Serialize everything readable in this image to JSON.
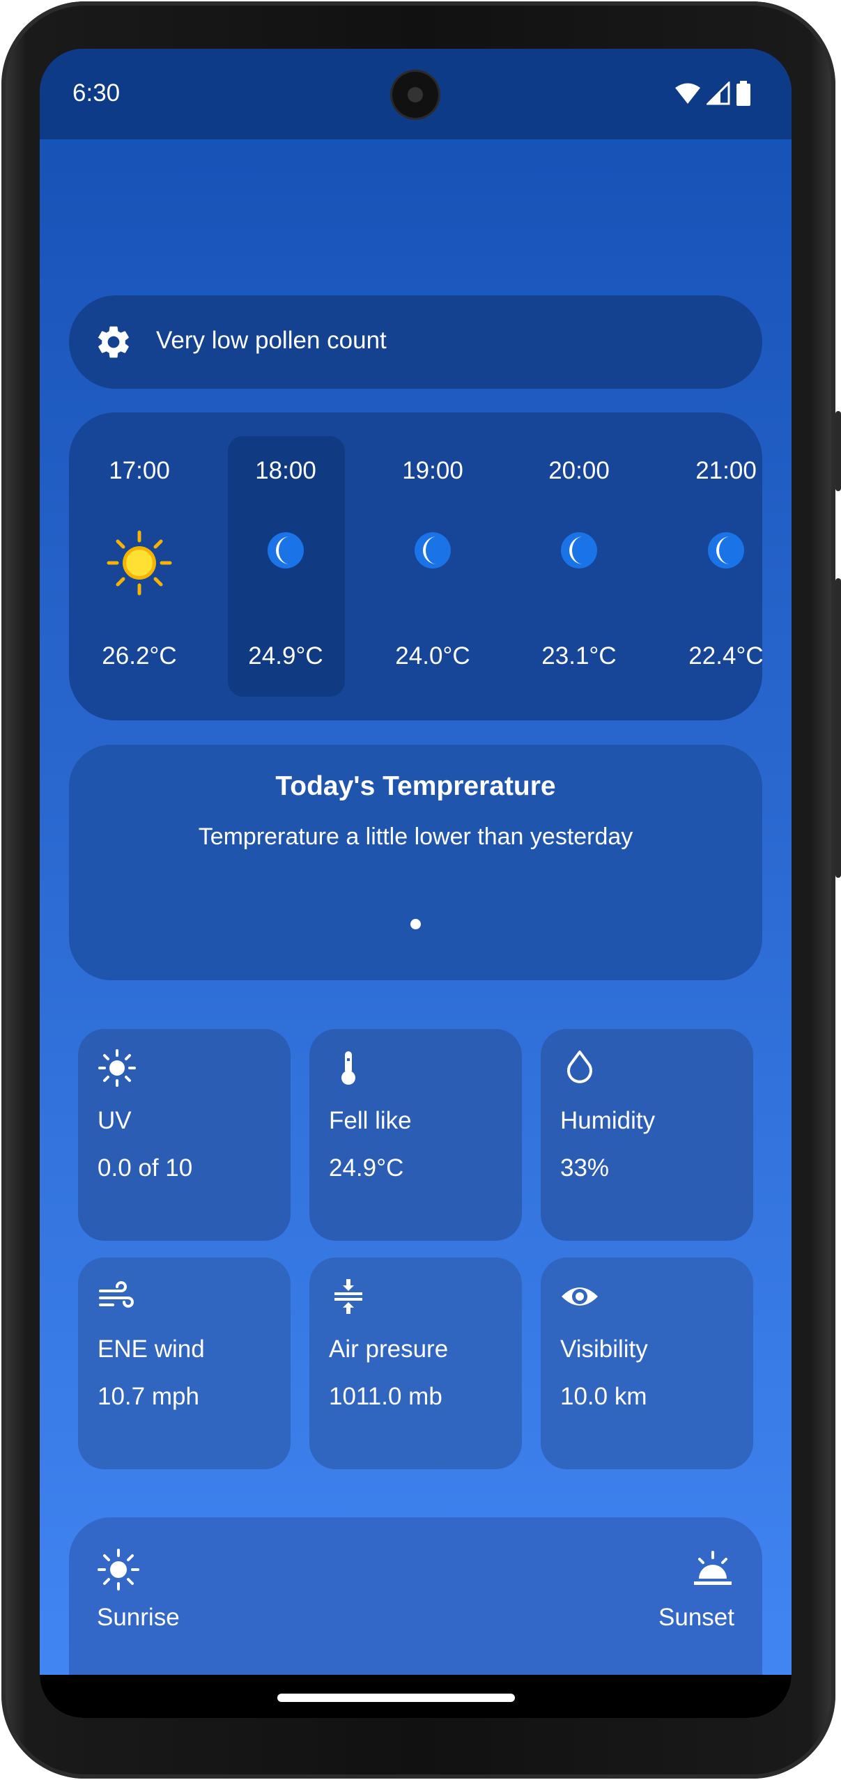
{
  "status_bar": {
    "time": "6:30",
    "icons": [
      "wifi-icon",
      "signal-icon",
      "battery-icon"
    ]
  },
  "pollen": {
    "icon": "gear-icon",
    "text": "Very low pollen count"
  },
  "hourly": [
    {
      "time": "17:00",
      "icon": "sun-icon",
      "temp": "26.2°C",
      "selected": false
    },
    {
      "time": "18:00",
      "icon": "moon-icon",
      "temp": "24.9°C",
      "selected": true
    },
    {
      "time": "19:00",
      "icon": "moon-icon",
      "temp": "24.0°C",
      "selected": false
    },
    {
      "time": "20:00",
      "icon": "moon-icon",
      "temp": "23.1°C",
      "selected": false
    },
    {
      "time": "21:00",
      "icon": "moon-icon",
      "temp": "22.4°C",
      "selected": false
    }
  ],
  "temperature_card": {
    "title": "Today's Temprerature",
    "subtitle": "Temprerature a little lower than yesterday",
    "page_count": 1,
    "page_index": 0
  },
  "tiles": [
    {
      "icon": "uv-sun-icon",
      "label": "UV",
      "value": "0.0  of 10"
    },
    {
      "icon": "thermometer-icon",
      "label": "Fell like",
      "value": "24.9°C"
    },
    {
      "icon": "water-drop-icon",
      "label": "Humidity",
      "value": "33%"
    },
    {
      "icon": "wind-icon",
      "label": "ENE wind",
      "value": "10.7 mph"
    },
    {
      "icon": "compress-icon",
      "label": "Air presure",
      "value": "1011.0 mb"
    },
    {
      "icon": "eye-icon",
      "label": "Visibility",
      "value": "10.0 km"
    }
  ],
  "sun": {
    "sunrise_label": "Sunrise",
    "sunrise_icon": "sun-icon",
    "sunset_label": "Sunset",
    "sunset_icon": "sunset-icon"
  },
  "colors": {
    "status_bar": "#0e3b87",
    "pollen_card": "#144290",
    "hourly_card": "#174597",
    "hourly_selected": "#103a82",
    "temperature_card": "#2055ad",
    "tile": "#2e62bd",
    "sun_icon": "#f4c20d",
    "moon_icon": "#1b73e8"
  }
}
